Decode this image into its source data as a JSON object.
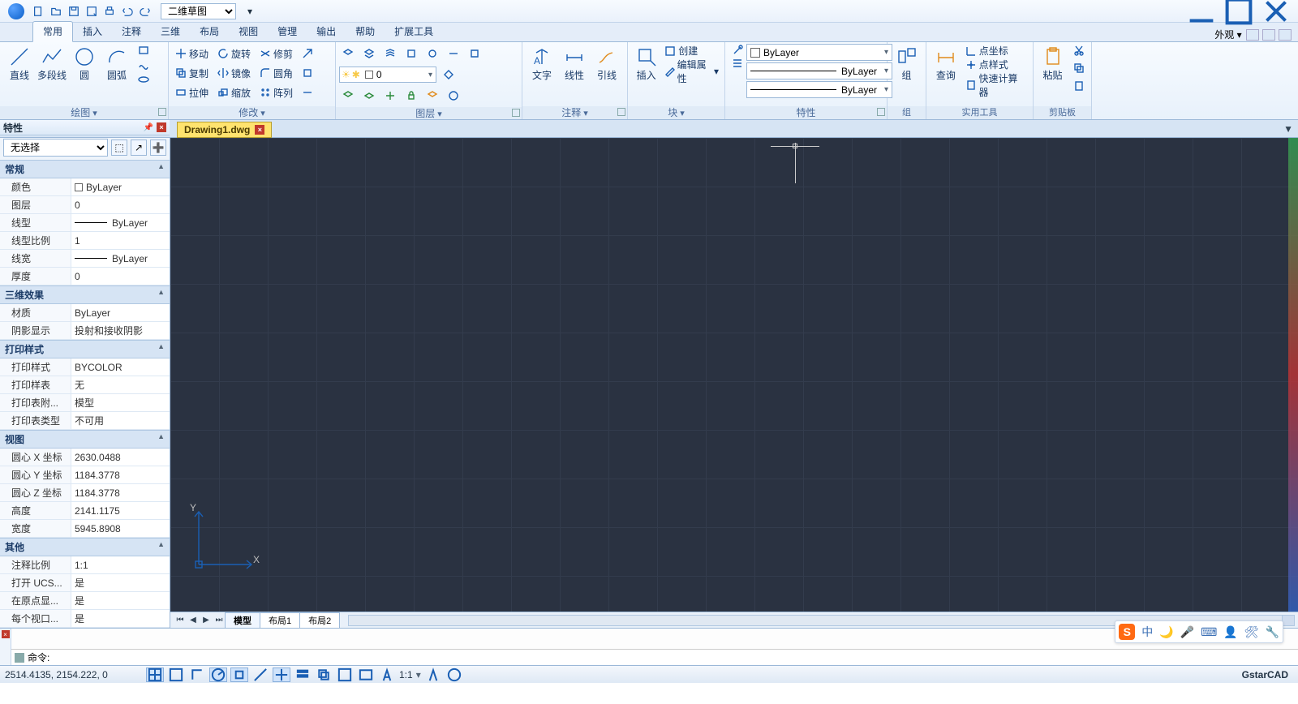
{
  "titlebar": {
    "workspace": "二维草图",
    "appearance_label": "外观"
  },
  "ribbon": {
    "tabs": [
      "常用",
      "插入",
      "注释",
      "三维",
      "布局",
      "视图",
      "管理",
      "输出",
      "帮助",
      "扩展工具"
    ],
    "active_tab": 0,
    "draw": {
      "title": "绘图",
      "line": "直线",
      "polyline": "多段线",
      "circle": "圆",
      "arc": "圆弧"
    },
    "modify": {
      "title": "修改",
      "move": "移动",
      "rotate": "旋转",
      "trim": "修剪",
      "copy": "复制",
      "mirror": "镜像",
      "fillet": "圆角",
      "stretch": "拉伸",
      "scale": "缩放",
      "array": "阵列"
    },
    "layer": {
      "title": "图层",
      "current": "0"
    },
    "annotate": {
      "title": "注释",
      "text": "文字",
      "dim": "线性",
      "leader": "引线"
    },
    "block": {
      "title": "块",
      "insert": "插入",
      "create": "创建",
      "edit_attr": "编辑属性"
    },
    "props": {
      "title": "特性",
      "bylayer": "ByLayer"
    },
    "group": {
      "title": "组",
      "group": "组"
    },
    "utils": {
      "title": "实用工具",
      "query": "查询",
      "pointcoord": "点坐标",
      "pointstyle": "点样式",
      "calc": "快速计算器"
    },
    "clip": {
      "title": "剪贴板",
      "paste": "粘贴"
    }
  },
  "doc": {
    "name": "Drawing1.dwg"
  },
  "properties": {
    "title": "特性",
    "selection": "无选择",
    "sections": {
      "general": "常规",
      "effect3d": "三维效果",
      "printstyle": "打印样式",
      "view": "视图",
      "other": "其他"
    },
    "general": {
      "color_k": "颜色",
      "color_v": "ByLayer",
      "layer_k": "图层",
      "layer_v": "0",
      "ltype_k": "线型",
      "ltype_v": "ByLayer",
      "ltscale_k": "线型比例",
      "ltscale_v": "1",
      "lweight_k": "线宽",
      "lweight_v": "ByLayer",
      "thick_k": "厚度",
      "thick_v": "0"
    },
    "effect3d": {
      "mat_k": "材质",
      "mat_v": "ByLayer",
      "shadow_k": "阴影显示",
      "shadow_v": "投射和接收阴影"
    },
    "printstyle": {
      "ps_k": "打印样式",
      "ps_v": "BYCOLOR",
      "pst_k": "打印样表",
      "pst_v": "无",
      "pta_k": "打印表附...",
      "pta_v": "模型",
      "ptt_k": "打印表类型",
      "ptt_v": "不可用"
    },
    "view": {
      "cx_k": "圆心 X 坐标",
      "cx_v": "2630.0488",
      "cy_k": "圆心 Y 坐标",
      "cy_v": "1184.3778",
      "cz_k": "圆心 Z 坐标",
      "cz_v": "1184.3778",
      "h_k": "高度",
      "h_v": "2141.1175",
      "w_k": "宽度",
      "w_v": "5945.8908"
    },
    "other": {
      "as_k": "注释比例",
      "as_v": "1:1",
      "ucs_k": "打开 UCS...",
      "ucs_v": "是",
      "orig_k": "在原点显...",
      "orig_v": "是",
      "vp_k": "每个视口...",
      "vp_v": "是"
    }
  },
  "layout_tabs": {
    "model": "模型",
    "l1": "布局1",
    "l2": "布局2"
  },
  "command": {
    "prompt": "命令:"
  },
  "status": {
    "coords": "2514.4135, 2154.222, 0",
    "scale": "1:1",
    "brand": "GstarCAD"
  },
  "ime": {
    "label": "中"
  }
}
